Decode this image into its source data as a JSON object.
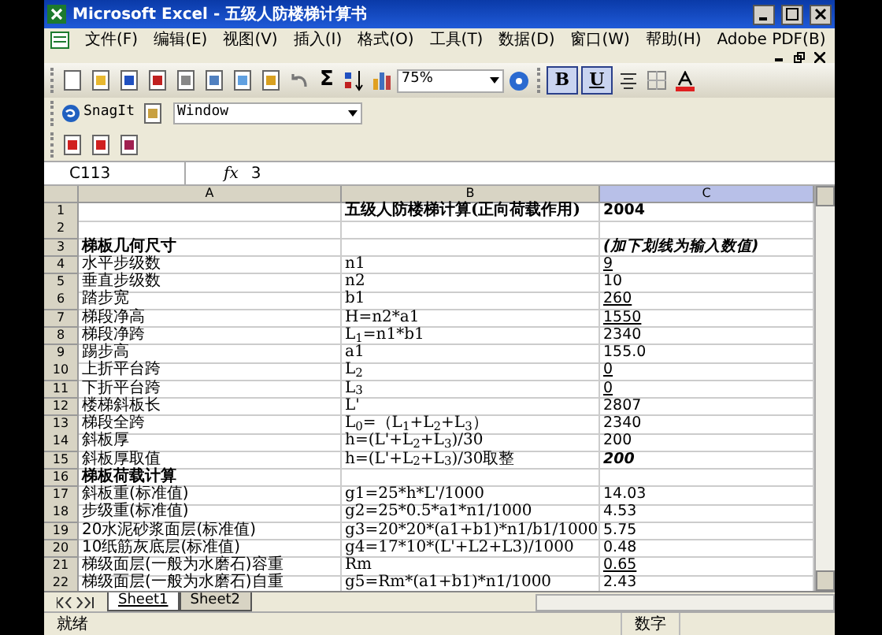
{
  "window": {
    "title": "Microsoft Excel - 五级人防楼梯计算书"
  },
  "menu": [
    "文件(F)",
    "编辑(E)",
    "视图(V)",
    "插入(I)",
    "格式(O)",
    "工具(T)",
    "数据(D)",
    "窗口(W)",
    "帮助(H)",
    "Adobe PDF(B)"
  ],
  "toolbar": {
    "sum": "Σ",
    "zoom": "75%",
    "bold": {
      "label": "B",
      "pressed": true
    },
    "underline": {
      "label": "U",
      "pressed": true
    }
  },
  "snagit": {
    "label": "SnagIt",
    "capture_mode": "Window"
  },
  "formula_bar": {
    "name_box": "C113",
    "fx": "fx",
    "value": "3"
  },
  "columns": [
    {
      "label": "A",
      "selected": false
    },
    {
      "label": "B",
      "selected": false
    },
    {
      "label": "C",
      "selected": true
    }
  ],
  "rows": [
    {
      "num": "1",
      "kind": "title",
      "a": "",
      "b": "五级人防楼梯计算(正向荷载作用)",
      "c": "2004",
      "c_bold": true,
      "c_italic": false,
      "c_underline": false
    },
    {
      "num": "2",
      "kind": "data",
      "a": "",
      "b": "",
      "c": ""
    },
    {
      "num": "3",
      "kind": "section",
      "a": "梯板几何尺寸",
      "b": "",
      "c": "(加下划线为输入数值)",
      "c_bold": true,
      "c_italic": true,
      "c_underline": false
    },
    {
      "num": "4",
      "kind": "data",
      "a": "水平步级数",
      "b": "n1",
      "c": "9",
      "c_bold": false,
      "c_italic": false,
      "c_underline": true
    },
    {
      "num": "5",
      "kind": "data",
      "a": "垂直步级数",
      "b": "n2",
      "c": "10",
      "c_bold": false,
      "c_italic": false,
      "c_underline": false
    },
    {
      "num": "6",
      "kind": "data",
      "a": "踏步宽",
      "b": "b1",
      "c": "260",
      "c_bold": false,
      "c_italic": false,
      "c_underline": true
    },
    {
      "num": "7",
      "kind": "data",
      "a": "梯段净高",
      "b": "H=n2*a1",
      "c": "1550",
      "c_bold": false,
      "c_italic": false,
      "c_underline": true
    },
    {
      "num": "8",
      "kind": "data",
      "a": "梯段净跨",
      "b": "L$_{1}$=n1*b1",
      "c": "2340",
      "c_bold": false,
      "c_italic": false,
      "c_underline": false
    },
    {
      "num": "9",
      "kind": "data",
      "a": "踢步高",
      "b": "a1",
      "c": "155.0",
      "c_bold": false,
      "c_italic": false,
      "c_underline": false
    },
    {
      "num": "10",
      "kind": "data",
      "a": "上折平台跨",
      "b": "L$_{2}$",
      "c": "0",
      "c_bold": false,
      "c_italic": false,
      "c_underline": true
    },
    {
      "num": "11",
      "kind": "data",
      "a": "下折平台跨",
      "b": "L$_{3}$",
      "c": "0",
      "c_bold": false,
      "c_italic": false,
      "c_underline": true
    },
    {
      "num": "12",
      "kind": "data",
      "a": "楼梯斜板长",
      "b": "L'",
      "c": "2807",
      "c_bold": false,
      "c_italic": false,
      "c_underline": false
    },
    {
      "num": "13",
      "kind": "data",
      "a": "梯段全跨",
      "b": "L$_{0}$=（L$_{1}$+L$_{2}$+L$_{3}$）",
      "c": "2340",
      "c_bold": false,
      "c_italic": false,
      "c_underline": false
    },
    {
      "num": "14",
      "kind": "data",
      "a": "斜板厚",
      "b": "h=(L'+L$_{2}$+L$_{3}$)/30",
      "c": "200",
      "c_bold": false,
      "c_italic": false,
      "c_underline": false
    },
    {
      "num": "15",
      "kind": "data",
      "a": "斜板厚取值",
      "b": "h=(L'+L$_{2}$+L$_{3}$)/30取整",
      "c": "200",
      "c_bold": true,
      "c_italic": true,
      "c_underline": false
    },
    {
      "num": "16",
      "kind": "section",
      "a": "梯板荷载计算",
      "b": "",
      "c": ""
    },
    {
      "num": "17",
      "kind": "data",
      "a": "斜板重(标准值)",
      "b": "g1=25*h*L'/1000",
      "c": "14.03",
      "c_bold": false,
      "c_italic": false,
      "c_underline": false
    },
    {
      "num": "18",
      "kind": "data",
      "a": "步级重(标准值)",
      "b": "g2=25*0.5*a1*n1/1000",
      "c": "4.53",
      "c_bold": false,
      "c_italic": false,
      "c_underline": false
    },
    {
      "num": "19",
      "kind": "data",
      "a": "20水泥砂浆面层(标准值)",
      "b": "g3=20*20*(a1+b1)*n1/b1/1000",
      "c": "5.75",
      "c_bold": false,
      "c_italic": false,
      "c_underline": false
    },
    {
      "num": "20",
      "kind": "data",
      "a": "10纸筋灰底层(标准值)",
      "b": "g4=17*10*(L'+L2+L3)/1000",
      "c": "0.48",
      "c_bold": false,
      "c_italic": false,
      "c_underline": false
    },
    {
      "num": "21",
      "kind": "data",
      "a": "梯级面层(一般为水磨石)容重",
      "b": "Rm",
      "c": "0.65",
      "c_bold": false,
      "c_italic": false,
      "c_underline": true
    },
    {
      "num": "22",
      "kind": "data",
      "a": "梯级面层(一般为水磨石)自重",
      "b": "g5=Rm*(a1+b1)*n1/1000",
      "c": "2.43",
      "c_bold": false,
      "c_italic": false,
      "c_underline": false
    }
  ],
  "sheets": [
    {
      "label": "Sheet1",
      "selected": true
    },
    {
      "label": "Sheet2",
      "selected": false
    }
  ],
  "status_bar": {
    "status": "就绪",
    "mode": "数字"
  }
}
